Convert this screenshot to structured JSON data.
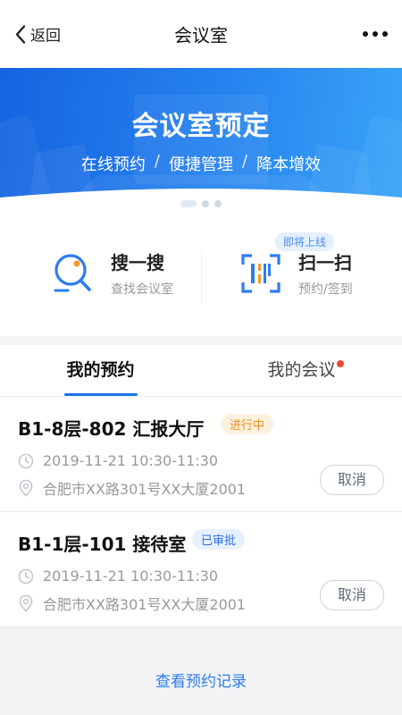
{
  "nav": {
    "back_label": "返回",
    "title": "会议室",
    "more_icon": "more-dots-icon"
  },
  "banner": {
    "title": "会议室预定",
    "subtitle_items": [
      "在线预约",
      "便捷管理",
      "降本增效"
    ],
    "separator": "/",
    "slides_total": 3,
    "active_slide": 1,
    "colors": {
      "start": "#1663e0",
      "end": "#3aa6f8"
    }
  },
  "actions": {
    "search": {
      "title": "搜一搜",
      "subtitle": "查找会议室",
      "icon": "search-icon"
    },
    "scan": {
      "title": "扫一扫",
      "subtitle": "预约/签到",
      "icon": "scan-qrcode-icon",
      "badge": "即将上线"
    }
  },
  "tabs": [
    {
      "label": "我的预约",
      "active": true
    },
    {
      "label": "我的会议",
      "active": false,
      "has_notification": true
    }
  ],
  "bookings": [
    {
      "room": "B1-8层-802 汇报大厅",
      "status": "进行中",
      "time": "2019-11-21 10:30-11:30",
      "address": "合肥市XX路301号XX大厦2001",
      "action": "取消"
    },
    {
      "room": "B1-1层-101 接待室",
      "status": "已审批",
      "time": "2019-11-21 10:30-11:30",
      "address": "合肥市XX路301号XX大厦2001",
      "action": "取消"
    }
  ],
  "footer": {
    "view_records": "查看预约记录"
  },
  "colors": {
    "accent": "#1a73e8",
    "status_progress": "#f08c18",
    "status_approved": "#2d6fe0",
    "notification": "#f5462c"
  }
}
